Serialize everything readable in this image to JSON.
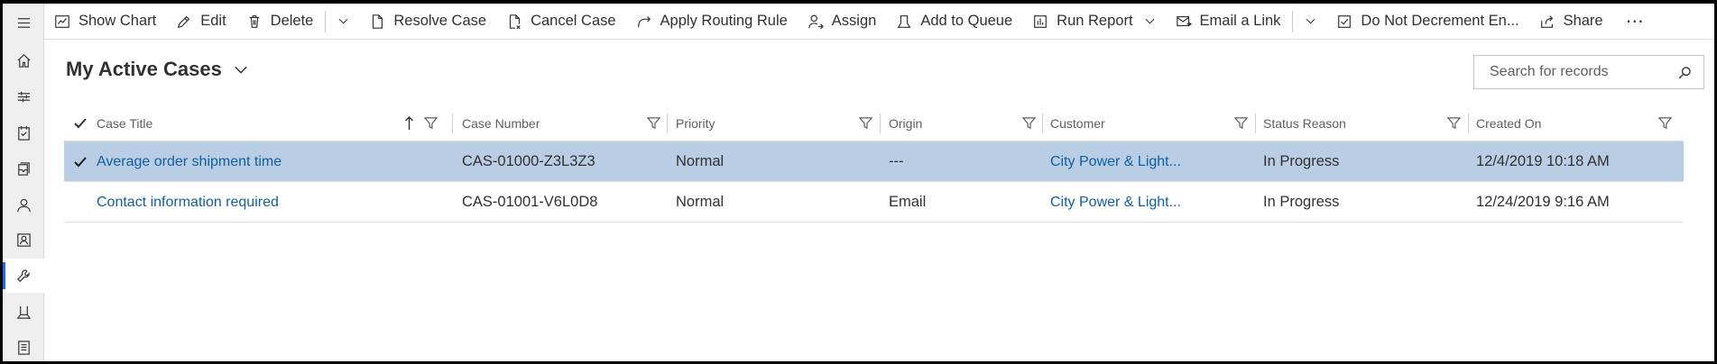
{
  "commands": [
    {
      "label": "Show Chart",
      "icon": "chart-icon"
    },
    {
      "label": "Edit",
      "icon": "pencil-icon"
    },
    {
      "label": "Delete",
      "icon": "trash-icon"
    },
    {
      "label": "Resolve Case",
      "icon": "resolve-case-icon"
    },
    {
      "label": "Cancel Case",
      "icon": "cancel-case-icon"
    },
    {
      "label": "Apply Routing Rule",
      "icon": "routing-rule-icon"
    },
    {
      "label": "Assign",
      "icon": "assign-icon"
    },
    {
      "label": "Add to Queue",
      "icon": "add-to-queue-icon"
    },
    {
      "label": "Run Report",
      "icon": "report-icon"
    },
    {
      "label": "Email a Link",
      "icon": "email-link-icon"
    },
    {
      "label": "Do Not Decrement En...",
      "icon": "checklist-icon"
    },
    {
      "label": "Share",
      "icon": "share-icon"
    },
    {
      "label": "⋯",
      "icon": "more-icon"
    }
  ],
  "rail": [
    "menu-icon",
    "home-icon",
    "pinned-icon",
    "activities-icon",
    "queues-icon",
    "contacts-icon",
    "social-profiles-icon",
    "service-tools-icon",
    "knowledge-icon",
    "reports-icon"
  ],
  "view": {
    "title": "My Active Cases"
  },
  "search": {
    "placeholder": "Search for records"
  },
  "grid": {
    "columns": [
      "Case Title",
      "Case Number",
      "Priority",
      "Origin",
      "Customer",
      "Status Reason",
      "Created On"
    ],
    "sorted_column": "Case Title",
    "rows": [
      {
        "selected": true,
        "title": "Average order shipment time",
        "number": "CAS-01000-Z3L3Z3",
        "priority": "Normal",
        "origin": "---",
        "customer": "City Power & Light...",
        "status": "In Progress",
        "created": "12/4/2019 10:18 AM"
      },
      {
        "selected": false,
        "title": "Contact information required",
        "number": "CAS-01001-V6L0D8",
        "priority": "Normal",
        "origin": "Email",
        "customer": "City Power & Light...",
        "status": "In Progress",
        "created": "12/24/2019 9:16 AM"
      }
    ]
  },
  "colors": {
    "selected_row": "#b9cee4",
    "link": "#115ea3",
    "accent": "#2266e3"
  }
}
